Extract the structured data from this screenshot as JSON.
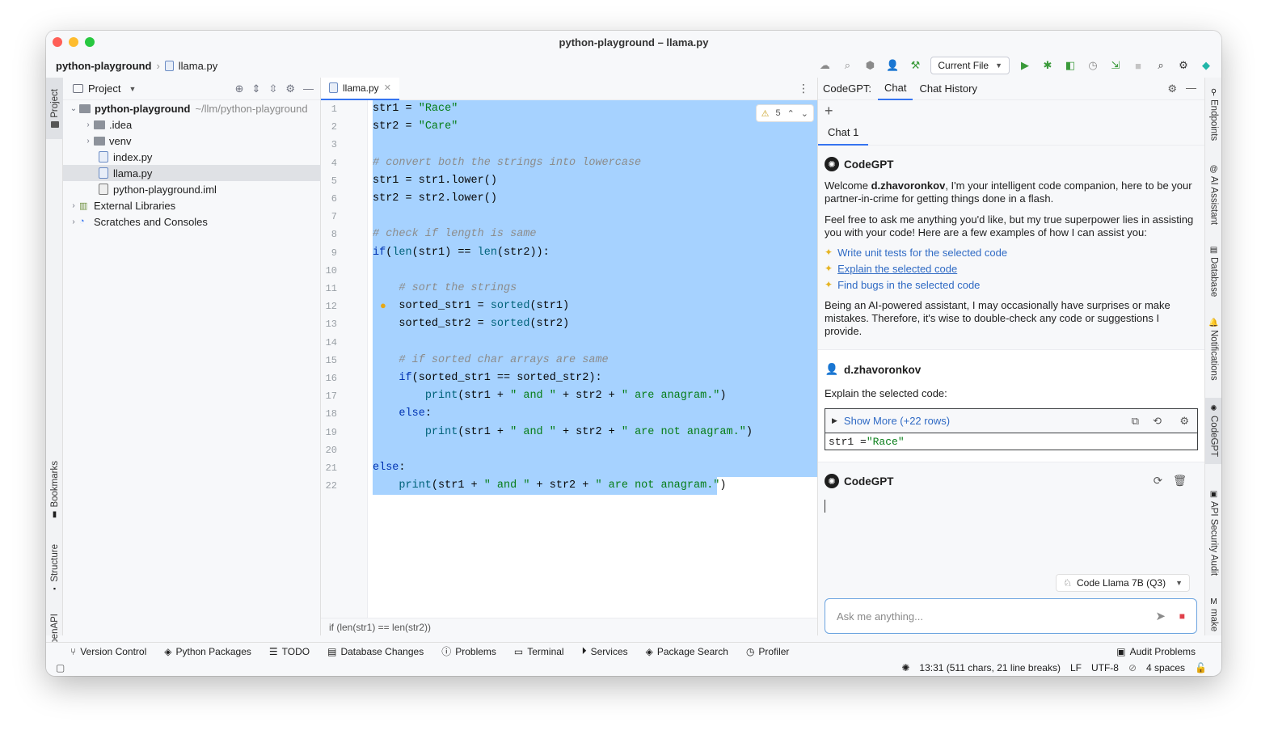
{
  "window": {
    "title": "python-playground – llama.py"
  },
  "breadcrumb": {
    "project": "python-playground",
    "file": "llama.py"
  },
  "toolbar": {
    "run_config": "Current File"
  },
  "left_strip": {
    "project": "Project",
    "bookmarks": "Bookmarks",
    "structure": "Structure",
    "openapi": "OpenAPI"
  },
  "project_panel": {
    "title": "Project",
    "tree": [
      {
        "label": "python-playground",
        "suffix": "~/llm/python-playground",
        "type": "root"
      },
      {
        "label": ".idea",
        "type": "folder"
      },
      {
        "label": "venv",
        "type": "folder"
      },
      {
        "label": "index.py",
        "type": "file"
      },
      {
        "label": "llama.py",
        "type": "file"
      },
      {
        "label": "python-playground.iml",
        "type": "file"
      },
      {
        "label": "External Libraries",
        "type": "lib"
      },
      {
        "label": "Scratches and Consoles",
        "type": "lib"
      }
    ]
  },
  "editor": {
    "tab": "llama.py",
    "inspection_count": "5",
    "status_line": "if (len(str1) == len(str2))",
    "line_numbers": [
      "1",
      "2",
      "3",
      "4",
      "5",
      "6",
      "7",
      "8",
      "9",
      "10",
      "11",
      "12",
      "13",
      "14",
      "15",
      "16",
      "17",
      "18",
      "19",
      "20",
      "21",
      "22"
    ],
    "lines": [
      "str1 = \"Race\"",
      "str2 = \"Care\"",
      "",
      "# convert both the strings into lowercase",
      "str1 = str1.lower()",
      "str2 = str2.lower()",
      "",
      "# check if length is same",
      "if(len(str1) == len(str2)):",
      "",
      "    # sort the strings",
      "    sorted_str1 = sorted(str1)",
      "    sorted_str2 = sorted(str2)",
      "",
      "    # if sorted char arrays are same",
      "    if(sorted_str1 == sorted_str2):",
      "        print(str1 + \" and \" + str2 + \" are anagram.\")",
      "    else:",
      "        print(str1 + \" and \" + str2 + \" are not anagram.\")",
      "",
      "else:",
      "    print(str1 + \" and \" + str2 + \" are not anagram.\")"
    ]
  },
  "chat": {
    "header_label": "CodeGPT:",
    "tabs": [
      "Chat",
      "Chat History"
    ],
    "session_tab": "Chat 1",
    "bot_name": "CodeGPT",
    "welcome_prefix": "Welcome ",
    "welcome_user": "d.zhavoronkov",
    "welcome_rest": ", I'm your intelligent code companion, here to be your partner-in-crime for getting things done in a flash.",
    "intro": "Feel free to ask me anything you'd like, but my true superpower lies in assisting you with your code! Here are a few examples of how I can assist you:",
    "examples": [
      "Write unit tests for the selected code",
      "Explain the selected code",
      "Find bugs in the selected code"
    ],
    "disclaimer": "Being an AI-powered assistant, I may occasionally have surprises or make mistakes. Therefore, it's wise to double-check any code or suggestions I provide.",
    "user_name": "d.zhavoronkov",
    "user_message": "Explain the selected code:",
    "show_more": "Show More (+22 rows)",
    "code_preview_var": "str1 = ",
    "code_preview_str": "\"Race\"",
    "model": "Code Llama 7B (Q3)",
    "input_placeholder": "Ask me anything..."
  },
  "right_strip": {
    "endpoints": "Endpoints",
    "ai_assistant": "AI Assistant",
    "database": "Database",
    "notifications": "Notifications",
    "codegpt": "CodeGPT",
    "api_security": "API Security Audit",
    "make": "make"
  },
  "bottom_tools": [
    "Version Control",
    "Python Packages",
    "TODO",
    "Database Changes",
    "Problems",
    "Terminal",
    "Services",
    "Package Search",
    "Profiler"
  ],
  "audit_problems": "Audit Problems",
  "status": {
    "position": "13:31 (511 chars, 21 line breaks)",
    "line_sep": "LF",
    "encoding": "UTF-8",
    "indent": "4 spaces"
  },
  "colors": {
    "accent": "#3574f0",
    "selection": "#a6d2ff",
    "string": "#067d17",
    "keyword": "#0033b3",
    "comment": "#8c8c8c"
  }
}
